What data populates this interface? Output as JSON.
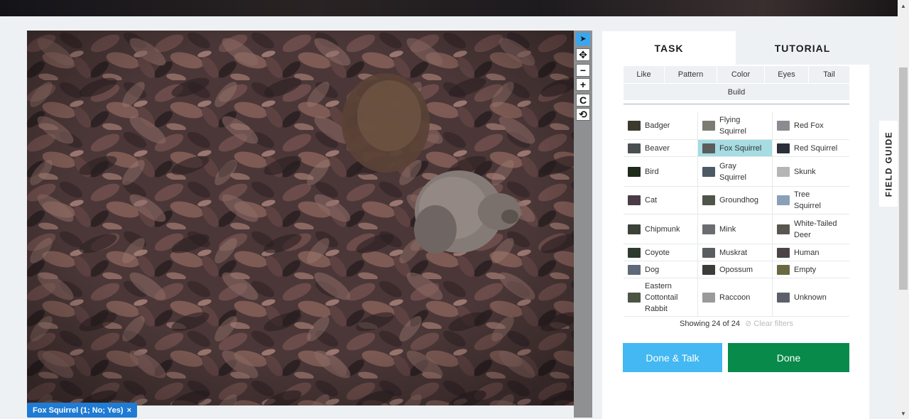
{
  "toolbar": {
    "tools": [
      {
        "name": "pointer-tool",
        "glyph": "➤",
        "active": true
      },
      {
        "name": "pan-tool",
        "glyph": "✥",
        "active": false
      },
      {
        "name": "zoom-out-tool",
        "glyph": "−",
        "active": false
      },
      {
        "name": "zoom-in-tool",
        "glyph": "+",
        "active": false
      },
      {
        "name": "rotate-tool",
        "glyph": "C",
        "active": false
      },
      {
        "name": "reset-tool",
        "glyph": "⟲",
        "active": false
      }
    ]
  },
  "annotation": {
    "label": "Fox Squirrel (1; No; Yes)",
    "remove_glyph": "×"
  },
  "panel": {
    "tabs": [
      "TASK",
      "TUTORIAL"
    ],
    "filters": [
      "Like",
      "Pattern",
      "Color",
      "Eyes",
      "Tail",
      "Build"
    ],
    "choices": [
      {
        "label": "Badger",
        "color": "#3b3a2c"
      },
      {
        "label": "Flying Squirrel",
        "color": "#7d7c74"
      },
      {
        "label": "Red Fox",
        "color": "#8a8c90"
      },
      {
        "label": "Beaver",
        "color": "#4a4f52"
      },
      {
        "label": "Fox Squirrel",
        "color": "#5a5d5c",
        "selected": true
      },
      {
        "label": "Red Squirrel",
        "color": "#2c2f3a"
      },
      {
        "label": "Bird",
        "color": "#1e2a1a"
      },
      {
        "label": "Gray Squirrel",
        "color": "#4c5a66"
      },
      {
        "label": "Skunk",
        "color": "#b5b5b5"
      },
      {
        "label": "Cat",
        "color": "#4a3c46"
      },
      {
        "label": "Groundhog",
        "color": "#50554a"
      },
      {
        "label": "Tree Squirrel",
        "color": "#8aa0b8"
      },
      {
        "label": "Chipmunk",
        "color": "#3b4238"
      },
      {
        "label": "Mink",
        "color": "#6a6c70"
      },
      {
        "label": "White-Tailed Deer",
        "color": "#595650"
      },
      {
        "label": "Coyote",
        "color": "#2e3a2e"
      },
      {
        "label": "Muskrat",
        "color": "#5a5e60"
      },
      {
        "label": "Human",
        "color": "#4a4448"
      },
      {
        "label": "Dog",
        "color": "#5e6a78"
      },
      {
        "label": "Opossum",
        "color": "#3c3c38"
      },
      {
        "label": "Empty",
        "color": "#6a6840"
      },
      {
        "label": "Eastern Cottontail Rabbit",
        "color": "#4c5444"
      },
      {
        "label": "Raccoon",
        "color": "#9a9a9a"
      },
      {
        "label": "Unknown",
        "color": "#5c6068"
      }
    ],
    "count_text": "Showing 24 of 24",
    "clear_text": "⊘ Clear filters",
    "done_talk_label": "Done & Talk",
    "done_label": "Done"
  },
  "field_guide_label": "FIELD GUIDE",
  "colors": {
    "accent_blue": "#43b8f2",
    "done_green": "#078a4a",
    "selected_choice": "#a6dce2",
    "tag_blue": "#1f7bd4"
  }
}
